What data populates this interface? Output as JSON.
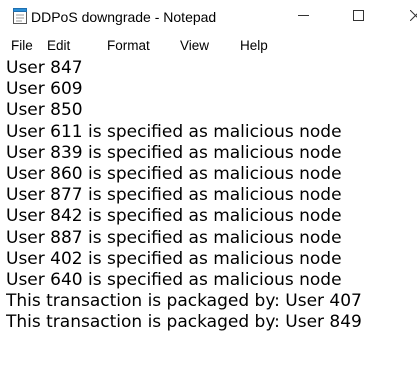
{
  "window": {
    "title": "DDPoS downgrade - Notepad",
    "icon": "notepad-icon",
    "controls": {
      "minimize": "minimize-icon",
      "maximize": "maximize-icon",
      "close": "close-icon"
    }
  },
  "menubar": {
    "items": [
      "File",
      "Edit",
      "Format",
      "View",
      "Help"
    ]
  },
  "editor": {
    "lines": [
      "User 847",
      "User 609",
      "User 850",
      "User 611 is specified as malicious node",
      "User 839 is specified as malicious node",
      "User 860 is specified as malicious node",
      "User 877 is specified as malicious node",
      "User 842 is specified as malicious node",
      "User 887 is specified as malicious node",
      "User 402 is specified as malicious node",
      "User 640 is specified as malicious node",
      "This transaction is packaged by: User 407",
      "This transaction is packaged by: User 849"
    ]
  },
  "colors": {
    "background": "#ffffff",
    "text": "#000000",
    "icon_blue": "#2b8fd6"
  }
}
